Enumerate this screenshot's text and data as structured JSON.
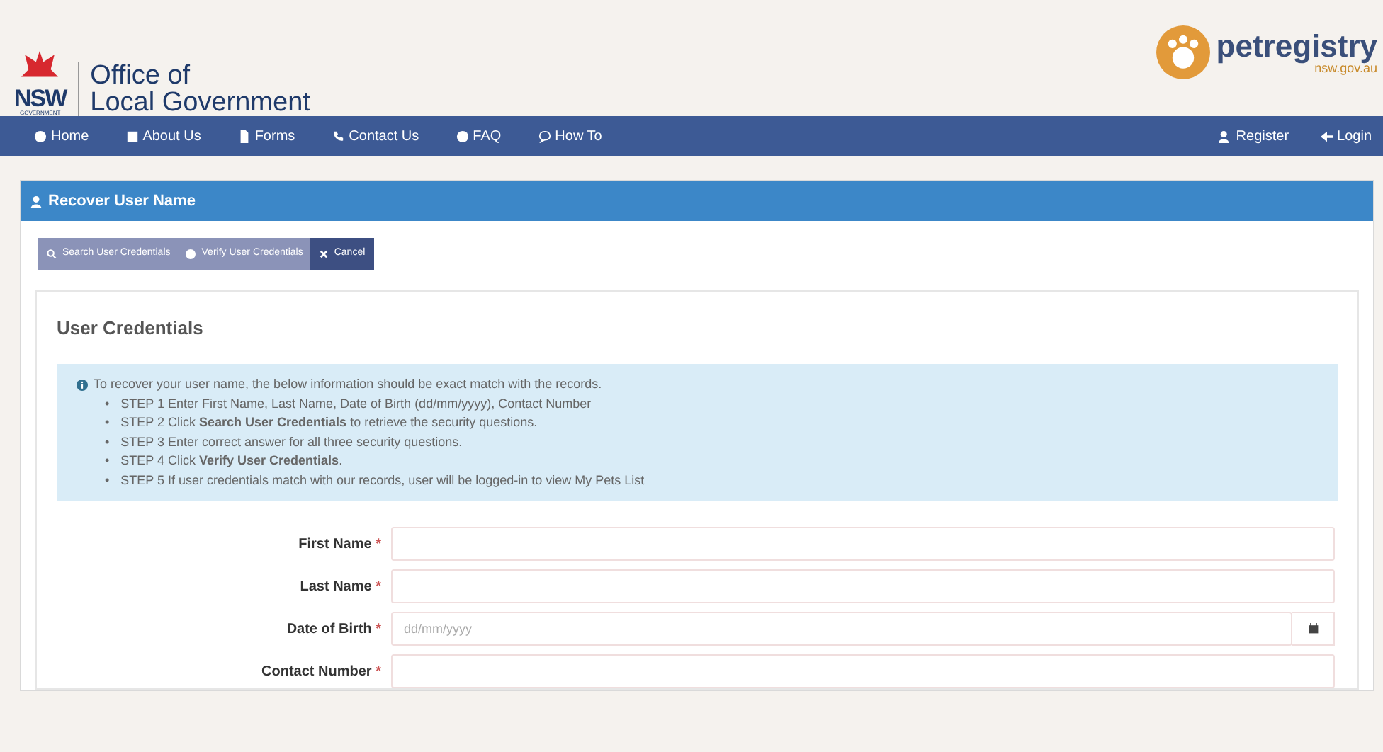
{
  "header": {
    "org_logo": {
      "mark": "NSW",
      "tagline": "GOVERNMENT",
      "name_line_1": "Office of",
      "name_line_2": "Local Government"
    },
    "site_logo": {
      "name": "petregistry",
      "domain": "nsw.gov.au"
    }
  },
  "nav": {
    "left": [
      {
        "label": "Home"
      },
      {
        "label": "About Us"
      },
      {
        "label": "Forms"
      },
      {
        "label": "Contact Us"
      },
      {
        "label": "FAQ"
      },
      {
        "label": "How To"
      }
    ],
    "right": [
      {
        "label": "Register"
      },
      {
        "label": "Login"
      }
    ]
  },
  "panel": {
    "title": "Recover User Name",
    "buttons": [
      {
        "label": "Search User Credentials",
        "kind": "search",
        "disabled": true
      },
      {
        "label": "Verify User Credentials",
        "kind": "verify",
        "disabled": true
      },
      {
        "label": "Cancel",
        "kind": "cancel",
        "disabled": false
      }
    ],
    "section_title": "User Credentials",
    "info": {
      "step_marker": "•",
      "intro": "To recover your user name, the below information should be exact match with the records.",
      "steps": [
        "STEP 1 Enter First Name, Last Name, Date of Birth (dd/mm/yyyy), Contact Number",
        "STEP 2 Click **Search User Credentials** to retrieve the security questions.",
        "STEP 3 Enter correct answer for all three security questions.",
        "STEP 4 Click **Verify User Credentials**.",
        "STEP 5 If user credentials match with our records, user will be logged-in to view My Pets List"
      ]
    },
    "fields": [
      {
        "label": "First Name",
        "required_mark": "*",
        "kind": "text"
      },
      {
        "label": "Last Name",
        "required_mark": "*",
        "kind": "text"
      },
      {
        "label": "Date of Birth",
        "required_mark": "*",
        "kind": "date",
        "placeholder": "dd/mm/yyyy"
      },
      {
        "label": "Contact Number",
        "required_mark": "*",
        "kind": "text"
      }
    ]
  }
}
